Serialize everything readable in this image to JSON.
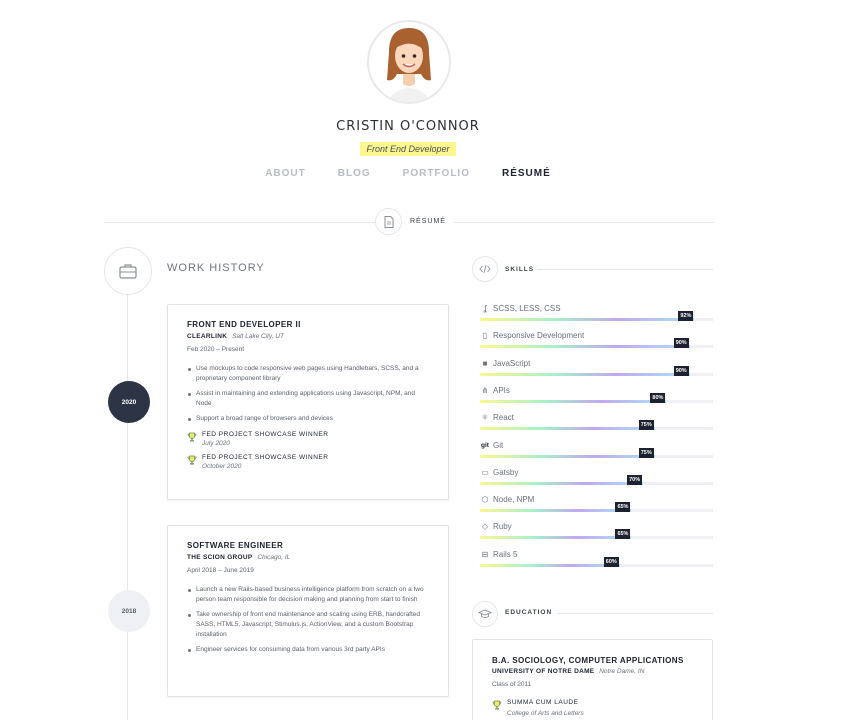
{
  "header": {
    "name": "CRISTIN O'CONNOR",
    "role": "Front End Developer",
    "nav": [
      {
        "label": "ABOUT",
        "active": false
      },
      {
        "label": "BLOG",
        "active": false
      },
      {
        "label": "PORTFOLIO",
        "active": false
      },
      {
        "label": "RÉSUMÉ",
        "active": true
      }
    ]
  },
  "section": {
    "label": "RÉSUMÉ",
    "icon": "document-icon"
  },
  "work": {
    "title": "WORK HISTORY",
    "icon": "briefcase-icon",
    "jobs": [
      {
        "year": "2020",
        "title": "FRONT END DEVELOPER II",
        "company": "CLEARLINK",
        "location": "Salt Lake City, UT",
        "dates": "Feb 2020 – Present",
        "bullets": [
          "Use mockups to code responsive web pages using Handlebars, SCSS, and a proprietary component library",
          "Assist in maintaining and extending applications using Javascript, NPM, and Node",
          "Support a broad range of browsers and devices"
        ],
        "awards": [
          {
            "title": "FED PROJECT SHOWCASE WINNER",
            "date": "July 2020"
          },
          {
            "title": "FED PROJECT SHOWCASE WINNER",
            "date": "October 2020"
          }
        ]
      },
      {
        "year": "2018",
        "title": "SOFTWARE ENGINEER",
        "company": "THE SCION GROUP",
        "location": "Chicago, IL",
        "dates": "April 2018 – June 2019",
        "bullets": [
          "Launch a new Rails-based business intelligence platform from scratch on a two person team responsible for decision making and planning from start to finish",
          "Take ownership of front end maintenance and scaling using ERB, handcrafted SASS, HTML5, Javascript, Stimulus.js, ActionView, and a custom Bootstrap installation",
          "Engineer services for consuming data from various 3rd party APIs"
        ]
      }
    ]
  },
  "skills": {
    "title": "SKILLS",
    "icon": "code-icon",
    "items": [
      {
        "name": "SCSS, LESS, CSS",
        "percent": 92,
        "label": "92%",
        "icon": "sass-icon",
        "glyph": "ʆ"
      },
      {
        "name": "Responsive Development",
        "percent": 90,
        "label": "90%",
        "icon": "mobile-icon",
        "glyph": "▯"
      },
      {
        "name": "JavaScript",
        "percent": 90,
        "label": "90%",
        "icon": "javascript-icon",
        "glyph": "■"
      },
      {
        "name": "APIs",
        "percent": 80,
        "label": "80%",
        "icon": "network-icon",
        "glyph": "⋔"
      },
      {
        "name": "React",
        "percent": 75,
        "label": "75%",
        "icon": "react-icon",
        "glyph": "⚛"
      },
      {
        "name": "Git",
        "percent": 75,
        "label": "75%",
        "icon": "git-icon",
        "glyph": "git"
      },
      {
        "name": "Gatsby",
        "percent": 70,
        "label": "70%",
        "icon": "browser-icon",
        "glyph": "▭"
      },
      {
        "name": "Node, NPM",
        "percent": 65,
        "label": "65%",
        "icon": "node-icon",
        "glyph": "⬡"
      },
      {
        "name": "Ruby",
        "percent": 65,
        "label": "65%",
        "icon": "ruby-icon",
        "glyph": "◇"
      },
      {
        "name": "Rails 5",
        "percent": 60,
        "label": "60%",
        "icon": "train-icon",
        "glyph": "⊟"
      }
    ]
  },
  "education": {
    "title": "EDUCATION",
    "icon": "graduation-cap-icon",
    "degree": "B.A. SOCIOLOGY, COMPUTER APPLICATIONS",
    "school": "UNIVERSITY OF NOTRE DAME",
    "location": "Notre Dame, IN",
    "class": "Class of 2011",
    "award": {
      "title": "SUMMA CUM LAUDE",
      "detail": "College of Arts and Letters"
    }
  },
  "colors": {
    "navy": "#2c3446",
    "highlight": "#fbf78e",
    "muted": "#b7bcc5"
  }
}
